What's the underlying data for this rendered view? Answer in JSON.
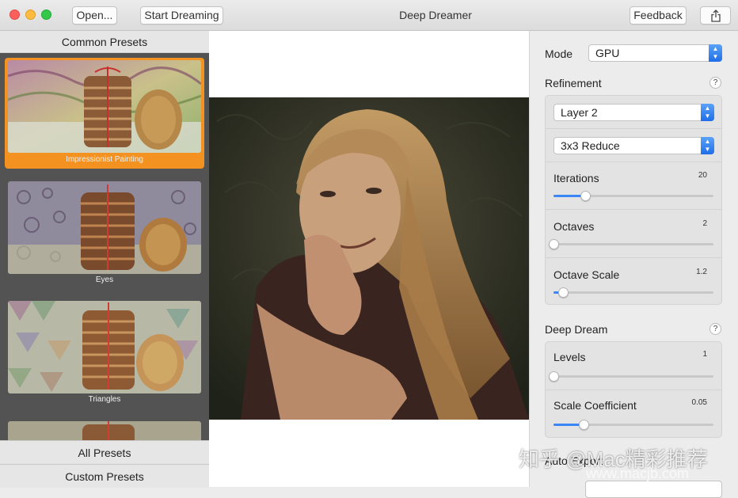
{
  "window": {
    "title": "Deep Dreamer",
    "open_label": "Open...",
    "start_label": "Start Dreaming",
    "feedback_label": "Feedback"
  },
  "presets": {
    "header": "Common Presets",
    "items": [
      {
        "label": "Impressionist Painting",
        "selected": true
      },
      {
        "label": "Eyes",
        "selected": false
      },
      {
        "label": "Triangles",
        "selected": false
      }
    ],
    "all_presets_label": "All Presets",
    "custom_presets_label": "Custom Presets"
  },
  "settings": {
    "mode_label": "Mode",
    "mode_value": "GPU",
    "refinement": {
      "title": "Refinement",
      "help": "?",
      "layer_value": "Layer 2",
      "reduce_value": "3x3 Reduce",
      "sliders": [
        {
          "label": "Iterations",
          "value": "20",
          "fraction": 0.2
        },
        {
          "label": "Octaves",
          "value": "2",
          "fraction": 0.0
        },
        {
          "label": "Octave Scale",
          "value": "1.2",
          "fraction": 0.06
        }
      ]
    },
    "deep_dream": {
      "title": "Deep Dream",
      "help": "?",
      "sliders": [
        {
          "label": "Levels",
          "value": "1",
          "fraction": 0.0
        },
        {
          "label": "Scale Coefficient",
          "value": "0.05",
          "fraction": 0.19
        }
      ]
    },
    "auto_export": {
      "title": "Auto Export"
    }
  },
  "watermark": {
    "main": "知乎 @Mac精彩推荐",
    "sub": "www.macjb.com"
  },
  "colors": {
    "accent": "#3b86f7",
    "selection": "#f39220",
    "panel_dark": "#535353"
  }
}
